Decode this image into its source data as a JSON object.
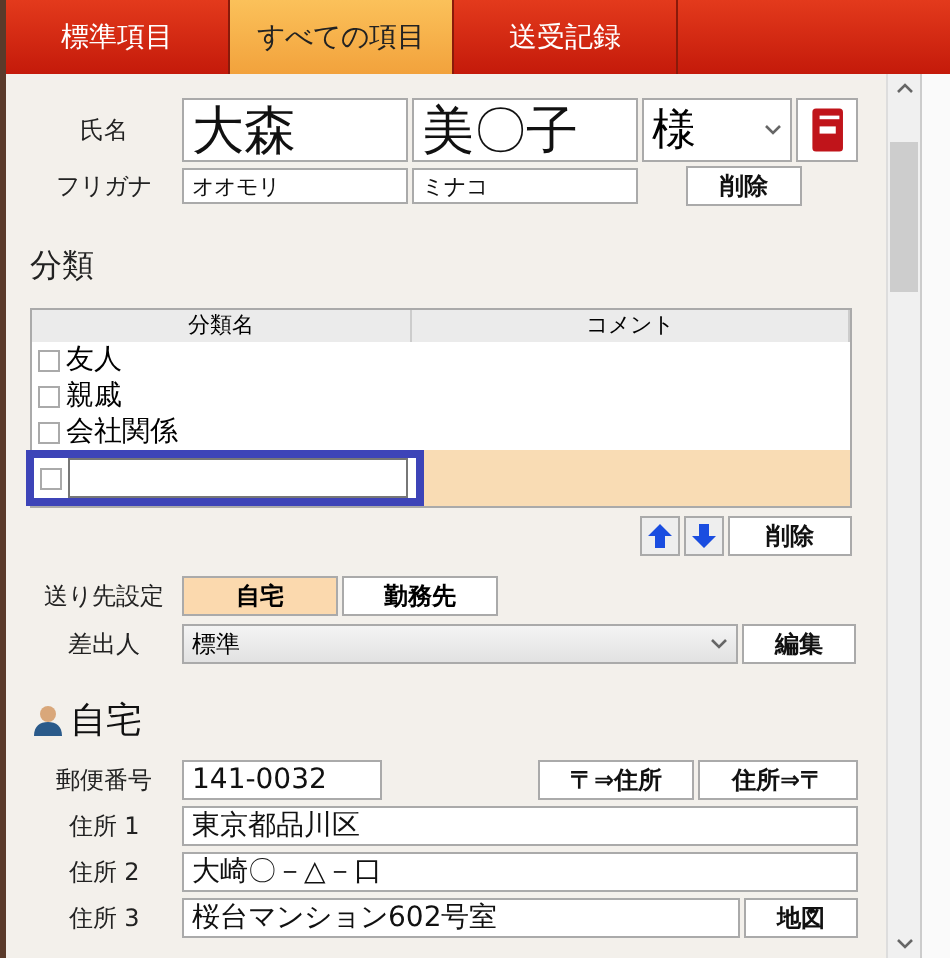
{
  "tabs": [
    {
      "label": "標準項目",
      "selected": false
    },
    {
      "label": "すべての項目",
      "selected": true
    },
    {
      "label": "送受記録",
      "selected": false
    }
  ],
  "name": {
    "label": "氏名",
    "last": "大森",
    "first": "美〇子",
    "honorific": "様",
    "furigana_label": "フリガナ",
    "furigana_last": "オオモリ",
    "furigana_first": "ミナコ",
    "delete_button": "削除"
  },
  "category": {
    "heading": "分類",
    "columns": [
      "分類名",
      "コメント"
    ],
    "rows": [
      {
        "kind": "text",
        "name": "友人",
        "checked": false,
        "selected": false
      },
      {
        "kind": "text",
        "name": "親戚",
        "checked": false,
        "selected": false
      },
      {
        "kind": "text",
        "name": "会社関係",
        "checked": false,
        "selected": false
      },
      {
        "kind": "editing",
        "checked": false,
        "selected": true
      }
    ],
    "delete_button": "削除"
  },
  "destination": {
    "label": "送り先設定",
    "options": [
      {
        "label": "自宅",
        "selected": true
      },
      {
        "label": "勤務先",
        "selected": false
      }
    ]
  },
  "sender": {
    "label": "差出人",
    "value": "標準",
    "edit_button": "編集"
  },
  "home": {
    "title": "自宅",
    "postal_label": "郵便番号",
    "postal_value": "141-0032",
    "postal_buttons": [
      "〒⇒住所",
      "住所⇒〒"
    ],
    "addresses": [
      {
        "label": "住所 1",
        "value": "東京都品川区"
      },
      {
        "label": "住所 2",
        "value": "大崎〇－△－口"
      },
      {
        "label": "住所 3",
        "value": "桜台マンション602号室"
      }
    ],
    "map_button": "地図"
  }
}
